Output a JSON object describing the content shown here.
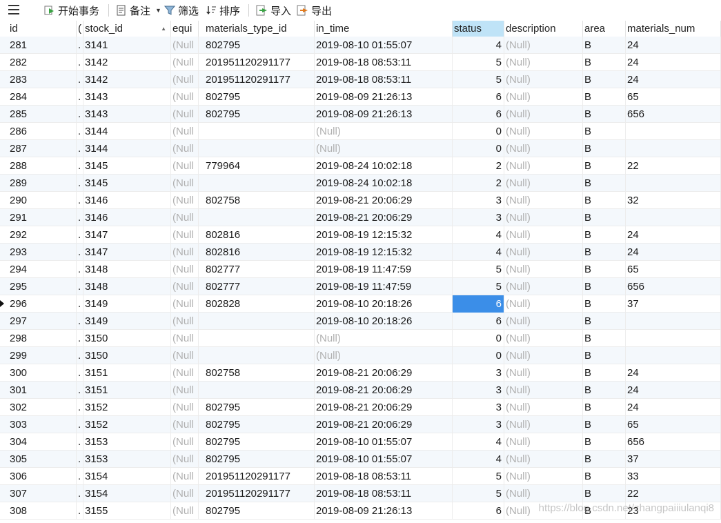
{
  "toolbar": {
    "begin_transaction": "开始事务",
    "memo": "备注",
    "filter": "筛选",
    "sort": "排序",
    "import": "导入",
    "export": "导出"
  },
  "columns": [
    "id",
    "(",
    "stock_id",
    "equi",
    "materials_type_id",
    "in_time",
    "status",
    "description",
    "area",
    "materials_num"
  ],
  "selected_row_id": "296",
  "rows": [
    {
      "id": "281",
      "c2": ".",
      "stock_id": "3141",
      "equip": "(Null",
      "type": "802795",
      "in_time": "2019-08-10 01:55:07",
      "status": "4",
      "desc": "(Null)",
      "area": "B",
      "num": "24"
    },
    {
      "id": "282",
      "c2": ".",
      "stock_id": "3142",
      "equip": "(Null",
      "type": "201951120291177",
      "in_time": "2019-08-18 08:53:11",
      "status": "5",
      "desc": "(Null)",
      "area": "B",
      "num": "24"
    },
    {
      "id": "283",
      "c2": ".",
      "stock_id": "3142",
      "equip": "(Null",
      "type": "201951120291177",
      "in_time": "2019-08-18 08:53:11",
      "status": "5",
      "desc": "(Null)",
      "area": "B",
      "num": "24"
    },
    {
      "id": "284",
      "c2": ".",
      "stock_id": "3143",
      "equip": "(Null",
      "type": "802795",
      "in_time": "2019-08-09 21:26:13",
      "status": "6",
      "desc": "(Null)",
      "area": "B",
      "num": "65"
    },
    {
      "id": "285",
      "c2": ".",
      "stock_id": "3143",
      "equip": "(Null",
      "type": "802795",
      "in_time": "2019-08-09 21:26:13",
      "status": "6",
      "desc": "(Null)",
      "area": "B",
      "num": "656"
    },
    {
      "id": "286",
      "c2": ".",
      "stock_id": "3144",
      "equip": "(Null",
      "type": "",
      "in_time": "(Null)",
      "status": "0",
      "desc": "(Null)",
      "area": "B",
      "num": ""
    },
    {
      "id": "287",
      "c2": ".",
      "stock_id": "3144",
      "equip": "(Null",
      "type": "",
      "in_time": "(Null)",
      "status": "0",
      "desc": "(Null)",
      "area": "B",
      "num": ""
    },
    {
      "id": "288",
      "c2": ".",
      "stock_id": "3145",
      "equip": "(Null",
      "type": "779964",
      "in_time": "2019-08-24 10:02:18",
      "status": "2",
      "desc": "(Null)",
      "area": "B",
      "num": "22"
    },
    {
      "id": "289",
      "c2": ".",
      "stock_id": "3145",
      "equip": "(Null",
      "type": "",
      "in_time": "2019-08-24 10:02:18",
      "status": "2",
      "desc": "(Null)",
      "area": "B",
      "num": ""
    },
    {
      "id": "290",
      "c2": ".",
      "stock_id": "3146",
      "equip": "(Null",
      "type": "802758",
      "in_time": "2019-08-21 20:06:29",
      "status": "3",
      "desc": "(Null)",
      "area": "B",
      "num": "32"
    },
    {
      "id": "291",
      "c2": ".",
      "stock_id": "3146",
      "equip": "(Null",
      "type": "",
      "in_time": "2019-08-21 20:06:29",
      "status": "3",
      "desc": "(Null)",
      "area": "B",
      "num": ""
    },
    {
      "id": "292",
      "c2": ".",
      "stock_id": "3147",
      "equip": "(Null",
      "type": "802816",
      "in_time": "2019-08-19 12:15:32",
      "status": "4",
      "desc": "(Null)",
      "area": "B",
      "num": "24"
    },
    {
      "id": "293",
      "c2": ".",
      "stock_id": "3147",
      "equip": "(Null",
      "type": "802816",
      "in_time": "2019-08-19 12:15:32",
      "status": "4",
      "desc": "(Null)",
      "area": "B",
      "num": "24"
    },
    {
      "id": "294",
      "c2": ".",
      "stock_id": "3148",
      "equip": "(Null",
      "type": "802777",
      "in_time": "2019-08-19 11:47:59",
      "status": "5",
      "desc": "(Null)",
      "area": "B",
      "num": "65"
    },
    {
      "id": "295",
      "c2": ".",
      "stock_id": "3148",
      "equip": "(Null",
      "type": "802777",
      "in_time": "2019-08-19 11:47:59",
      "status": "5",
      "desc": "(Null)",
      "area": "B",
      "num": "656"
    },
    {
      "id": "296",
      "c2": ".",
      "stock_id": "3149",
      "equip": "(Null",
      "type": "802828",
      "in_time": "2019-08-10 20:18:26",
      "status": "6",
      "desc": "(Null)",
      "area": "B",
      "num": "37"
    },
    {
      "id": "297",
      "c2": ".",
      "stock_id": "3149",
      "equip": "(Null",
      "type": "",
      "in_time": "2019-08-10 20:18:26",
      "status": "6",
      "desc": "(Null)",
      "area": "B",
      "num": ""
    },
    {
      "id": "298",
      "c2": ".",
      "stock_id": "3150",
      "equip": "(Null",
      "type": "",
      "in_time": "(Null)",
      "status": "0",
      "desc": "(Null)",
      "area": "B",
      "num": ""
    },
    {
      "id": "299",
      "c2": ".",
      "stock_id": "3150",
      "equip": "(Null",
      "type": "",
      "in_time": "(Null)",
      "status": "0",
      "desc": "(Null)",
      "area": "B",
      "num": ""
    },
    {
      "id": "300",
      "c2": ".",
      "stock_id": "3151",
      "equip": "(Null",
      "type": "802758",
      "in_time": "2019-08-21 20:06:29",
      "status": "3",
      "desc": "(Null)",
      "area": "B",
      "num": "24"
    },
    {
      "id": "301",
      "c2": ".",
      "stock_id": "3151",
      "equip": "(Null",
      "type": "",
      "in_time": "2019-08-21 20:06:29",
      "status": "3",
      "desc": "(Null)",
      "area": "B",
      "num": "24"
    },
    {
      "id": "302",
      "c2": ".",
      "stock_id": "3152",
      "equip": "(Null",
      "type": "802795",
      "in_time": "2019-08-21 20:06:29",
      "status": "3",
      "desc": "(Null)",
      "area": "B",
      "num": "24"
    },
    {
      "id": "303",
      "c2": ".",
      "stock_id": "3152",
      "equip": "(Null",
      "type": "802795",
      "in_time": "2019-08-21 20:06:29",
      "status": "3",
      "desc": "(Null)",
      "area": "B",
      "num": "65"
    },
    {
      "id": "304",
      "c2": ".",
      "stock_id": "3153",
      "equip": "(Null",
      "type": "802795",
      "in_time": "2019-08-10 01:55:07",
      "status": "4",
      "desc": "(Null)",
      "area": "B",
      "num": "656"
    },
    {
      "id": "305",
      "c2": ".",
      "stock_id": "3153",
      "equip": "(Null",
      "type": "802795",
      "in_time": "2019-08-10 01:55:07",
      "status": "4",
      "desc": "(Null)",
      "area": "B",
      "num": "37"
    },
    {
      "id": "306",
      "c2": ".",
      "stock_id": "3154",
      "equip": "(Null",
      "type": "201951120291177",
      "in_time": "2019-08-18 08:53:11",
      "status": "5",
      "desc": "(Null)",
      "area": "B",
      "num": "33"
    },
    {
      "id": "307",
      "c2": ".",
      "stock_id": "3154",
      "equip": "(Null",
      "type": "201951120291177",
      "in_time": "2019-08-18 08:53:11",
      "status": "5",
      "desc": "(Null)",
      "area": "B",
      "num": "22"
    },
    {
      "id": "308",
      "c2": ".",
      "stock_id": "3155",
      "equip": "(Null",
      "type": "802795",
      "in_time": "2019-08-09 21:26:13",
      "status": "6",
      "desc": "(Null)",
      "area": "B",
      "num": "23"
    }
  ],
  "watermark": "https://blog.csdn.net/zhangpaiiiulanqi8",
  "colors": {
    "selected_cell": "#3b8ee8",
    "sorted_header": "#bfe3f7",
    "null_text": "#b0b0b0"
  },
  "icons": [
    "menu-icon",
    "begin-transaction-icon",
    "memo-icon",
    "filter-icon",
    "sort-icon",
    "import-icon",
    "export-icon",
    "sort-asc-icon",
    "row-pointer-icon"
  ]
}
